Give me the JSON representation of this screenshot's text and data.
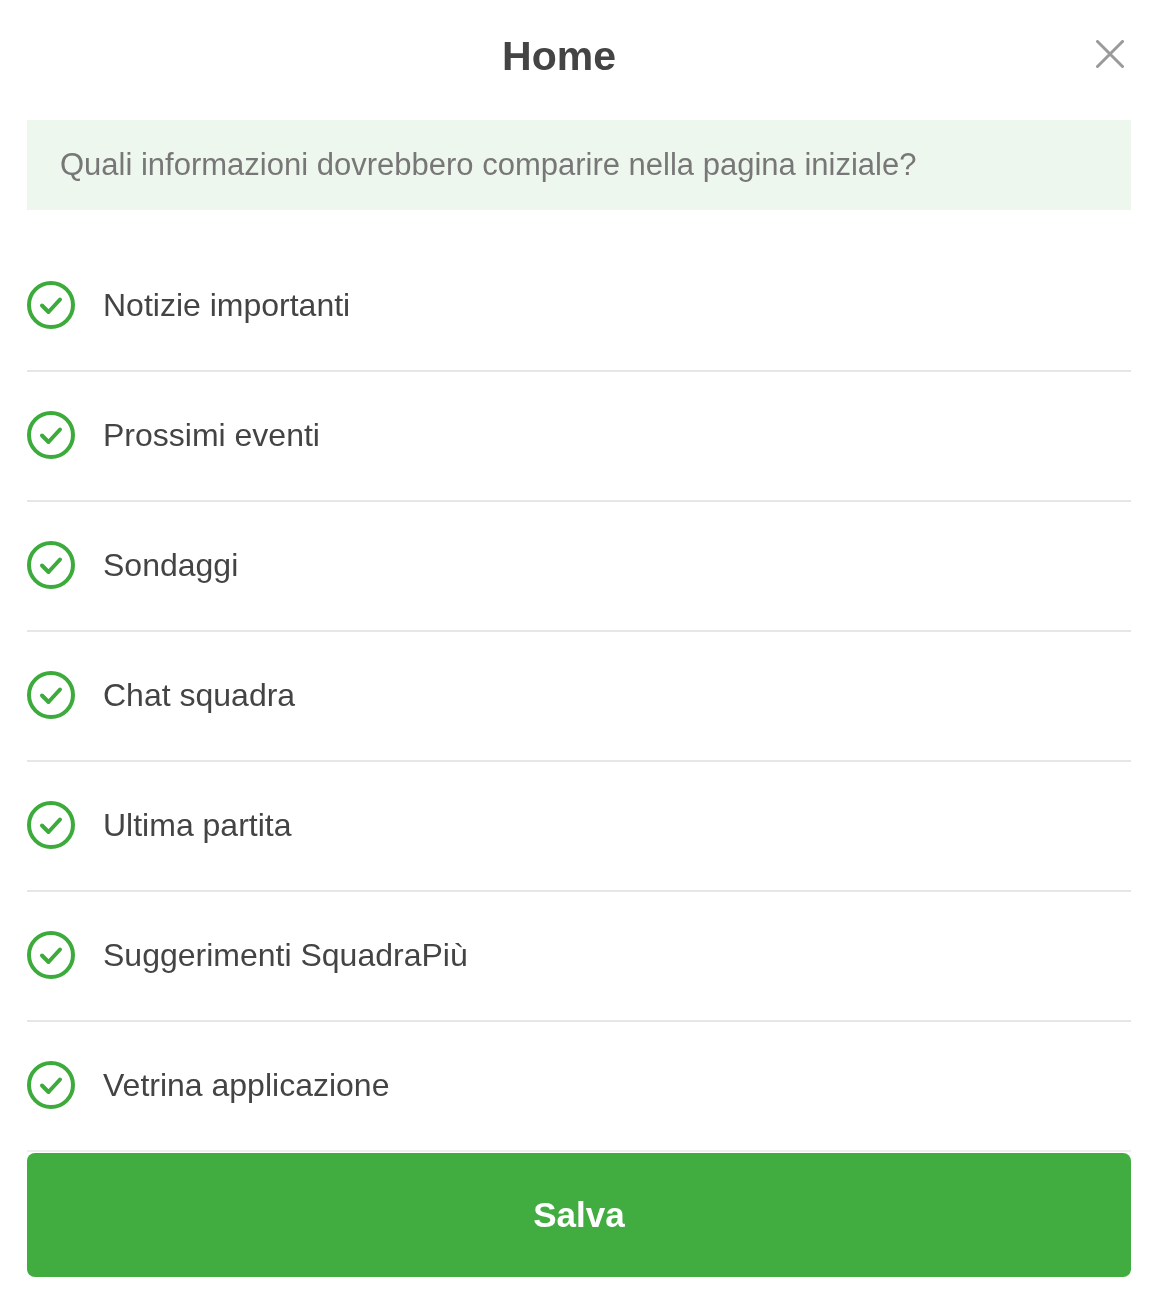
{
  "header": {
    "title": "Home"
  },
  "prompt": {
    "text": "Quali informazioni dovrebbero comparire nella pagina iniziale?"
  },
  "options": [
    {
      "label": "Notizie importanti",
      "checked": true
    },
    {
      "label": "Prossimi eventi",
      "checked": true
    },
    {
      "label": "Sondaggi",
      "checked": true
    },
    {
      "label": "Chat squadra",
      "checked": true
    },
    {
      "label": "Ultima partita",
      "checked": true
    },
    {
      "label": "Suggerimenti SquadraPiù",
      "checked": true
    },
    {
      "label": "Vetrina applicazione",
      "checked": true
    }
  ],
  "save_button": {
    "label": "Salva"
  }
}
